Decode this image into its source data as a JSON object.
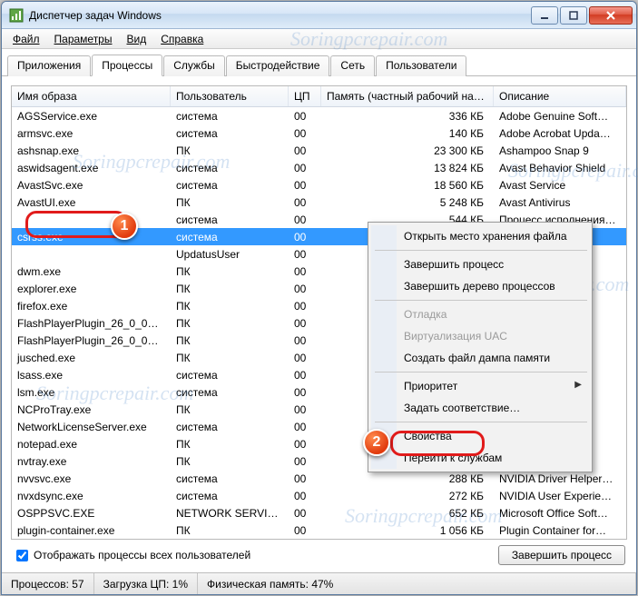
{
  "window": {
    "title": "Диспетчер задач Windows"
  },
  "menu": [
    "Файл",
    "Параметры",
    "Вид",
    "Справка"
  ],
  "tabs": [
    "Приложения",
    "Процессы",
    "Службы",
    "Быстродействие",
    "Сеть",
    "Пользователи"
  ],
  "active_tab_index": 1,
  "columns": {
    "image_name": "Имя образа",
    "user": "Пользователь",
    "cpu": "ЦП",
    "memory": "Память (частный рабочий набор)",
    "description": "Описание"
  },
  "processes": [
    {
      "name": "AGSService.exe",
      "user": "система",
      "cpu": "00",
      "mem": "336 КБ",
      "desc": "Adobe Genuine Soft…"
    },
    {
      "name": "armsvc.exe",
      "user": "система",
      "cpu": "00",
      "mem": "140 КБ",
      "desc": "Adobe Acrobat Upda…"
    },
    {
      "name": "ashsnap.exe",
      "user": "ПК",
      "cpu": "00",
      "mem": "23 300 КБ",
      "desc": "Ashampoo Snap 9"
    },
    {
      "name": "aswidsagent.exe",
      "user": "система",
      "cpu": "00",
      "mem": "13 824 КБ",
      "desc": "Avast Behavior Shield"
    },
    {
      "name": "AvastSvc.exe",
      "user": "система",
      "cpu": "00",
      "mem": "18 560 КБ",
      "desc": "Avast Service"
    },
    {
      "name": "AvastUI.exe",
      "user": "ПК",
      "cpu": "00",
      "mem": "5 248 КБ",
      "desc": "Avast Antivirus"
    },
    {
      "name": "",
      "user": "система",
      "cpu": "00",
      "mem": "544 КБ",
      "desc": "Процесс исполнения…"
    },
    {
      "name": "csrss.exe",
      "user": "система",
      "cpu": "00",
      "mem": "",
      "desc": "",
      "selected": true
    },
    {
      "name": "",
      "user": "UpdatusUser",
      "cpu": "00",
      "mem": "",
      "desc": ""
    },
    {
      "name": "dwm.exe",
      "user": "ПК",
      "cpu": "00",
      "mem": "",
      "desc": ""
    },
    {
      "name": "explorer.exe",
      "user": "ПК",
      "cpu": "00",
      "mem": "",
      "desc": ""
    },
    {
      "name": "firefox.exe",
      "user": "ПК",
      "cpu": "00",
      "mem": "",
      "desc": ""
    },
    {
      "name": "FlashPlayerPlugin_26_0_0_1…",
      "user": "ПК",
      "cpu": "00",
      "mem": "",
      "desc": ""
    },
    {
      "name": "FlashPlayerPlugin_26_0_0_1…",
      "user": "ПК",
      "cpu": "00",
      "mem": "",
      "desc": ""
    },
    {
      "name": "jusched.exe",
      "user": "ПК",
      "cpu": "00",
      "mem": "",
      "desc": ""
    },
    {
      "name": "lsass.exe",
      "user": "система",
      "cpu": "00",
      "mem": "",
      "desc": ""
    },
    {
      "name": "lsm.exe",
      "user": "система",
      "cpu": "00",
      "mem": "",
      "desc": ""
    },
    {
      "name": "NCProTray.exe",
      "user": "ПК",
      "cpu": "00",
      "mem": "",
      "desc": ""
    },
    {
      "name": "NetworkLicenseServer.exe",
      "user": "система",
      "cpu": "00",
      "mem": "",
      "desc": ""
    },
    {
      "name": "notepad.exe",
      "user": "ПК",
      "cpu": "00",
      "mem": "",
      "desc": ""
    },
    {
      "name": "nvtray.exe",
      "user": "ПК",
      "cpu": "00",
      "mem": "",
      "desc": ""
    },
    {
      "name": "nvvsvc.exe",
      "user": "система",
      "cpu": "00",
      "mem": "288 КБ",
      "desc": "NVIDIA Driver Helper…"
    },
    {
      "name": "nvxdsync.exe",
      "user": "система",
      "cpu": "00",
      "mem": "272 КБ",
      "desc": "NVIDIA User Experie…"
    },
    {
      "name": "OSPPSVC.EXE",
      "user": "NETWORK SERVICE",
      "cpu": "00",
      "mem": "652 КБ",
      "desc": "Microsoft Office Soft…"
    },
    {
      "name": "plugin-container.exe",
      "user": "ПК",
      "cpu": "00",
      "mem": "1 056 КБ",
      "desc": "Plugin Container for…"
    }
  ],
  "show_all_users_label": "Отображать процессы всех пользователей",
  "show_all_users_checked": true,
  "end_process_btn": "Завершить процесс",
  "status": {
    "processes_label": "Процессов:",
    "processes_value": "57",
    "cpu_label": "Загрузка ЦП:",
    "cpu_value": "1%",
    "mem_label": "Физическая память:",
    "mem_value": "47%"
  },
  "context_menu": [
    {
      "label": "Открыть место хранения файла",
      "type": "item"
    },
    {
      "type": "sep"
    },
    {
      "label": "Завершить процесс",
      "type": "item"
    },
    {
      "label": "Завершить дерево процессов",
      "type": "item"
    },
    {
      "type": "sep"
    },
    {
      "label": "Отладка",
      "type": "item",
      "disabled": true
    },
    {
      "label": "Виртуализация UAC",
      "type": "item",
      "disabled": true
    },
    {
      "label": "Создать файл дампа памяти",
      "type": "item"
    },
    {
      "type": "sep"
    },
    {
      "label": "Приоритет",
      "type": "submenu"
    },
    {
      "label": "Задать соответствие…",
      "type": "item"
    },
    {
      "type": "sep"
    },
    {
      "label": "Свойства",
      "type": "item",
      "highlight": true
    },
    {
      "label": "Перейти к службам",
      "type": "item"
    }
  ],
  "annotations": {
    "badge1": "1",
    "badge2": "2"
  },
  "watermark": "Soringpcrepair.com"
}
